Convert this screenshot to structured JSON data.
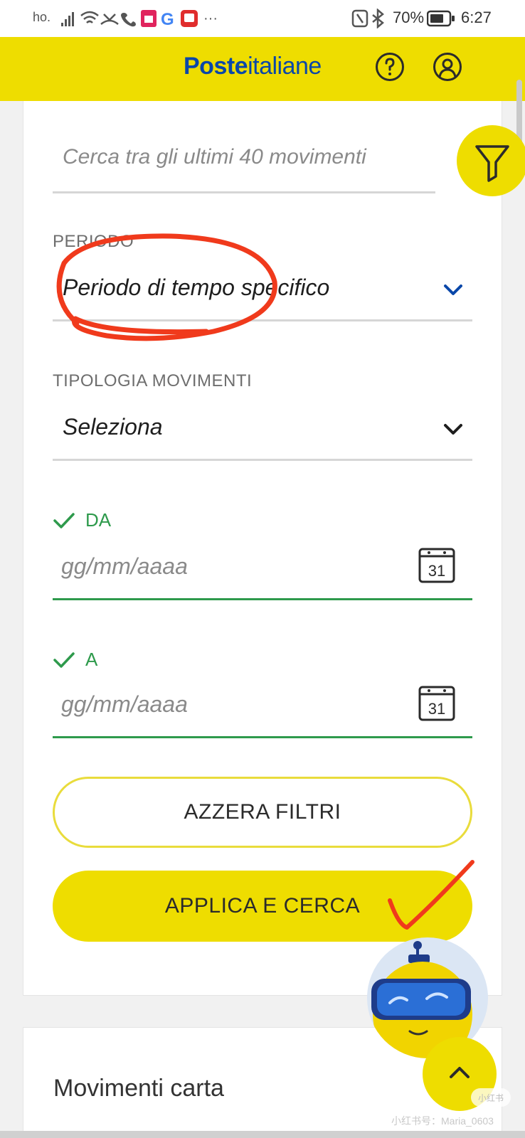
{
  "status_bar": {
    "carrier": "ho.",
    "battery": "70%",
    "time": "6:27",
    "overflow": "···"
  },
  "header": {
    "logo_bold": "Poste",
    "logo_light": "italiane",
    "brand_color": "#0a47a9",
    "accent_color": "#eedd00"
  },
  "filters": {
    "search_placeholder": "Cerca tra gli ultimi 40 movimenti",
    "periodo_label": "PERIODO",
    "periodo_value": "Periodo di tempo specifico",
    "tipologia_label": "TIPOLOGIA MOVIMENTI",
    "tipologia_value": "Seleziona",
    "da_label": "DA",
    "da_placeholder": "gg/mm/aaaa",
    "a_label": "A",
    "a_placeholder": "gg/mm/aaaa",
    "calendar_day": "31",
    "reset_label": "AZZERA FILTRI",
    "apply_label": "APPLICA E CERCA"
  },
  "movimenti": {
    "title": "Movimenti carta"
  },
  "watermark": {
    "badge": "小红书",
    "text": "小红书号：Maria_0603"
  },
  "icons": {
    "help": "question-circle-icon",
    "profile": "user-circle-icon",
    "filter": "funnel-icon",
    "chevron": "chevron-down-icon",
    "calendar": "calendar-icon",
    "check": "check-icon",
    "scroll_top": "chevron-up-icon"
  }
}
